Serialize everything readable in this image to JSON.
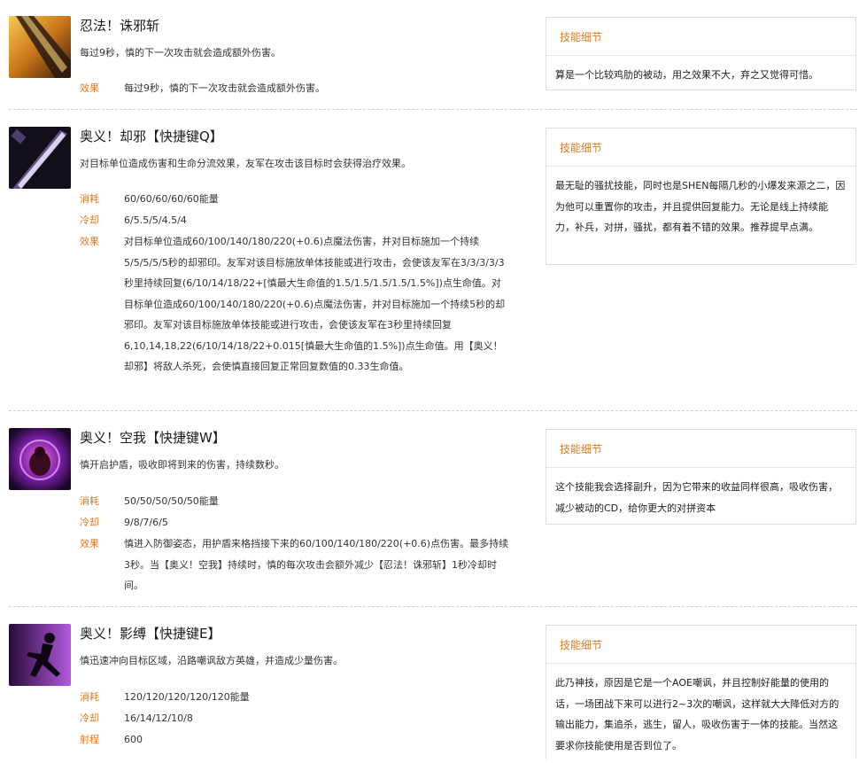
{
  "skills": [
    {
      "title": "忍法！诛邪斩",
      "desc": "每过9秒，慎的下一次攻击就会造成额外伤害。",
      "attrs": [
        {
          "label": "效果",
          "value": "每过9秒，慎的下一次攻击就会造成额外伤害。"
        }
      ],
      "panel": {
        "head": "技能细节",
        "body": "算是一个比较鸡肋的被动，用之效果不大，弃之又觉得可惜。"
      }
    },
    {
      "title": "奥义！却邪【快捷键Q】",
      "desc": "对目标单位造成伤害和生命分流效果，友军在攻击该目标时会获得治疗效果。",
      "attrs": [
        {
          "label": "消耗",
          "value": "60/60/60/60/60能量"
        },
        {
          "label": "冷却",
          "value": "6/5.5/5/4.5/4"
        },
        {
          "label": "效果",
          "value": "对目标单位造成60/100/140/180/220(+0.6)点魔法伤害，并对目标施加一个持续5/5/5/5/5秒的却邪印。友军对该目标施放单体技能或进行攻击，会使该友军在3/3/3/3/3秒里持续回复(6/10/14/18/22+[慎最大生命值的1.5/1.5/1.5/1.5/1.5%])点生命值。对目标单位造成60/100/140/180/220(+0.6)点魔法伤害，并对目标施加一个持续5秒的却邪印。友军对该目标施放单体技能或进行攻击，会使该友军在3秒里持续回复6,10,14,18,22(6/10/14/18/22+0.015[慎最大生命值的1.5%])点生命值。用【奥义！却邪】将敌人杀死，会使慎直接回复正常回复数值的0.33生命值。"
        }
      ],
      "panel": {
        "head": "技能细节",
        "body": "最无耻的骚扰技能，同时也是SHEN每隔几秒的小爆发来源之二，因为他可以重置你的攻击，并且提供回复能力。无论是线上持续能力，补兵，对拼，骚扰，都有着不错的效果。推荐提早点满。"
      }
    },
    {
      "title": "奥义！空我【快捷键W】",
      "desc": "慎开启护盾，吸收即将到来的伤害，持续数秒。",
      "attrs": [
        {
          "label": "消耗",
          "value": "50/50/50/50/50能量"
        },
        {
          "label": "冷却",
          "value": "9/8/7/6/5"
        },
        {
          "label": "效果",
          "value": "慎进入防御姿态，用护盾来格挡接下来的60/100/140/180/220(+0.6)点伤害。最多持续3秒。当【奥义！空我】持续时，慎的每次攻击会额外减少【忍法！诛邪斩】1秒冷却时间。"
        }
      ],
      "panel": {
        "head": "技能细节",
        "body": "这个技能我会选择副升，因为它带来的收益同样很高，吸收伤害，减少被动的CD，给你更大的对拼资本"
      }
    },
    {
      "title": "奥义！影缚【快捷键E】",
      "desc": "慎迅速冲向目标区域，沿路嘲讽敌方英雄，并造成少量伤害。",
      "attrs": [
        {
          "label": "消耗",
          "value": "120/120/120/120/120能量"
        },
        {
          "label": "冷却",
          "value": "16/14/12/10/8"
        },
        {
          "label": "射程",
          "value": "600"
        }
      ],
      "panel": {
        "head": "技能细节",
        "body": "此乃神技，原因是它是一个AOE嘲讽，并且控制好能量的使用的话，一场团战下来可以进行2~3次的嘲讽，这样就大大降低对方的输出能力，集追杀，逃生，留人，吸收伤害于一体的技能。当然这要求你技能使用是否到位了。"
      }
    }
  ],
  "icons": [
    "sword-icon",
    "blade-icon",
    "shield-orb-icon",
    "dash-silhouette-icon"
  ],
  "colors": {
    "accent": "#e07a1e",
    "border": "#dedede"
  }
}
